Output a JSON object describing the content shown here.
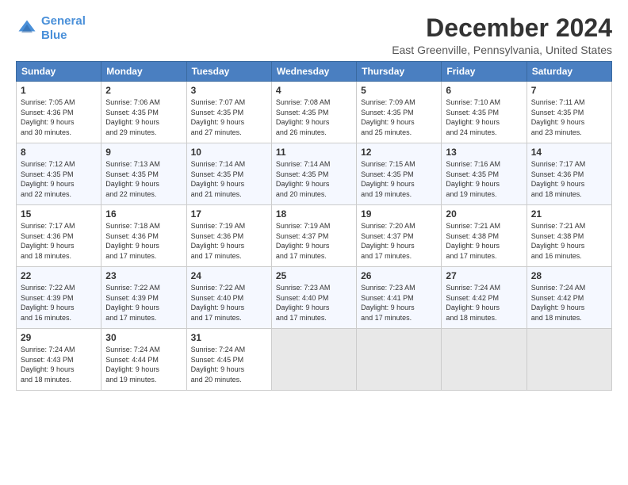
{
  "logo": {
    "line1": "General",
    "line2": "Blue"
  },
  "title": "December 2024",
  "subtitle": "East Greenville, Pennsylvania, United States",
  "header": {
    "days": [
      "Sunday",
      "Monday",
      "Tuesday",
      "Wednesday",
      "Thursday",
      "Friday",
      "Saturday"
    ]
  },
  "weeks": [
    [
      {
        "num": "1",
        "info": "Sunrise: 7:05 AM\nSunset: 4:36 PM\nDaylight: 9 hours\nand 30 minutes."
      },
      {
        "num": "2",
        "info": "Sunrise: 7:06 AM\nSunset: 4:35 PM\nDaylight: 9 hours\nand 29 minutes."
      },
      {
        "num": "3",
        "info": "Sunrise: 7:07 AM\nSunset: 4:35 PM\nDaylight: 9 hours\nand 27 minutes."
      },
      {
        "num": "4",
        "info": "Sunrise: 7:08 AM\nSunset: 4:35 PM\nDaylight: 9 hours\nand 26 minutes."
      },
      {
        "num": "5",
        "info": "Sunrise: 7:09 AM\nSunset: 4:35 PM\nDaylight: 9 hours\nand 25 minutes."
      },
      {
        "num": "6",
        "info": "Sunrise: 7:10 AM\nSunset: 4:35 PM\nDaylight: 9 hours\nand 24 minutes."
      },
      {
        "num": "7",
        "info": "Sunrise: 7:11 AM\nSunset: 4:35 PM\nDaylight: 9 hours\nand 23 minutes."
      }
    ],
    [
      {
        "num": "8",
        "info": "Sunrise: 7:12 AM\nSunset: 4:35 PM\nDaylight: 9 hours\nand 22 minutes."
      },
      {
        "num": "9",
        "info": "Sunrise: 7:13 AM\nSunset: 4:35 PM\nDaylight: 9 hours\nand 22 minutes."
      },
      {
        "num": "10",
        "info": "Sunrise: 7:14 AM\nSunset: 4:35 PM\nDaylight: 9 hours\nand 21 minutes."
      },
      {
        "num": "11",
        "info": "Sunrise: 7:14 AM\nSunset: 4:35 PM\nDaylight: 9 hours\nand 20 minutes."
      },
      {
        "num": "12",
        "info": "Sunrise: 7:15 AM\nSunset: 4:35 PM\nDaylight: 9 hours\nand 19 minutes."
      },
      {
        "num": "13",
        "info": "Sunrise: 7:16 AM\nSunset: 4:35 PM\nDaylight: 9 hours\nand 19 minutes."
      },
      {
        "num": "14",
        "info": "Sunrise: 7:17 AM\nSunset: 4:36 PM\nDaylight: 9 hours\nand 18 minutes."
      }
    ],
    [
      {
        "num": "15",
        "info": "Sunrise: 7:17 AM\nSunset: 4:36 PM\nDaylight: 9 hours\nand 18 minutes."
      },
      {
        "num": "16",
        "info": "Sunrise: 7:18 AM\nSunset: 4:36 PM\nDaylight: 9 hours\nand 17 minutes."
      },
      {
        "num": "17",
        "info": "Sunrise: 7:19 AM\nSunset: 4:36 PM\nDaylight: 9 hours\nand 17 minutes."
      },
      {
        "num": "18",
        "info": "Sunrise: 7:19 AM\nSunset: 4:37 PM\nDaylight: 9 hours\nand 17 minutes."
      },
      {
        "num": "19",
        "info": "Sunrise: 7:20 AM\nSunset: 4:37 PM\nDaylight: 9 hours\nand 17 minutes."
      },
      {
        "num": "20",
        "info": "Sunrise: 7:21 AM\nSunset: 4:38 PM\nDaylight: 9 hours\nand 17 minutes."
      },
      {
        "num": "21",
        "info": "Sunrise: 7:21 AM\nSunset: 4:38 PM\nDaylight: 9 hours\nand 16 minutes."
      }
    ],
    [
      {
        "num": "22",
        "info": "Sunrise: 7:22 AM\nSunset: 4:39 PM\nDaylight: 9 hours\nand 16 minutes."
      },
      {
        "num": "23",
        "info": "Sunrise: 7:22 AM\nSunset: 4:39 PM\nDaylight: 9 hours\nand 17 minutes."
      },
      {
        "num": "24",
        "info": "Sunrise: 7:22 AM\nSunset: 4:40 PM\nDaylight: 9 hours\nand 17 minutes."
      },
      {
        "num": "25",
        "info": "Sunrise: 7:23 AM\nSunset: 4:40 PM\nDaylight: 9 hours\nand 17 minutes."
      },
      {
        "num": "26",
        "info": "Sunrise: 7:23 AM\nSunset: 4:41 PM\nDaylight: 9 hours\nand 17 minutes."
      },
      {
        "num": "27",
        "info": "Sunrise: 7:24 AM\nSunset: 4:42 PM\nDaylight: 9 hours\nand 18 minutes."
      },
      {
        "num": "28",
        "info": "Sunrise: 7:24 AM\nSunset: 4:42 PM\nDaylight: 9 hours\nand 18 minutes."
      }
    ],
    [
      {
        "num": "29",
        "info": "Sunrise: 7:24 AM\nSunset: 4:43 PM\nDaylight: 9 hours\nand 18 minutes."
      },
      {
        "num": "30",
        "info": "Sunrise: 7:24 AM\nSunset: 4:44 PM\nDaylight: 9 hours\nand 19 minutes."
      },
      {
        "num": "31",
        "info": "Sunrise: 7:24 AM\nSunset: 4:45 PM\nDaylight: 9 hours\nand 20 minutes."
      },
      {
        "num": "",
        "info": ""
      },
      {
        "num": "",
        "info": ""
      },
      {
        "num": "",
        "info": ""
      },
      {
        "num": "",
        "info": ""
      }
    ]
  ]
}
